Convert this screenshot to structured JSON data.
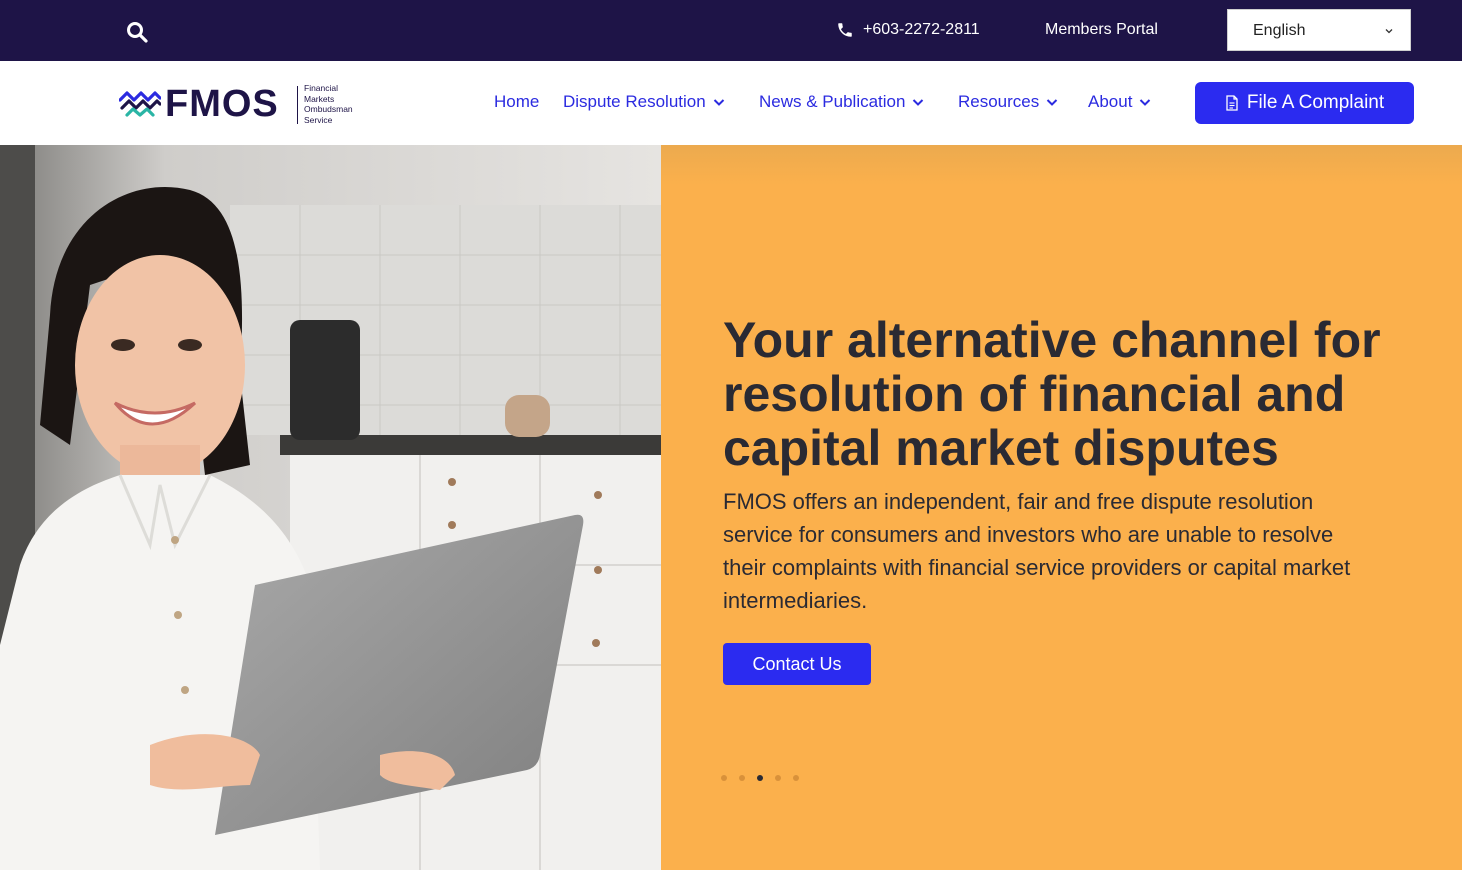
{
  "topbar": {
    "search_icon": "search-icon",
    "phone_icon": "phone-icon",
    "phone": "+603-2272-2811",
    "members_portal": "Members Portal",
    "language": {
      "selected": "English"
    },
    "bg_color": "#1e1447"
  },
  "header": {
    "logo": {
      "wordmark": "FMOS",
      "subtitle": [
        "Financial",
        "Markets",
        "Ombudsman",
        "Service"
      ]
    },
    "nav": [
      {
        "label": "Home",
        "has_dropdown": false
      },
      {
        "label": "Dispute Resolution",
        "has_dropdown": true
      },
      {
        "label": "News & Publication",
        "has_dropdown": true
      },
      {
        "label": "Resources",
        "has_dropdown": true
      },
      {
        "label": "About",
        "has_dropdown": true
      }
    ],
    "cta": {
      "label": "File A Complaint",
      "icon": "document-icon"
    }
  },
  "hero": {
    "title": "Your alternative channel for resolution of financial and capital market disputes",
    "description": "FMOS offers an independent, fair and free dispute resolution service for consumers and investors who are unable to resolve their complaints with financial service providers or capital market intermediaries.",
    "button": "Contact Us",
    "slides_total": 5,
    "active_slide": 3,
    "panel_color": "#fbb04c",
    "accent_color": "#2b2bf0"
  }
}
